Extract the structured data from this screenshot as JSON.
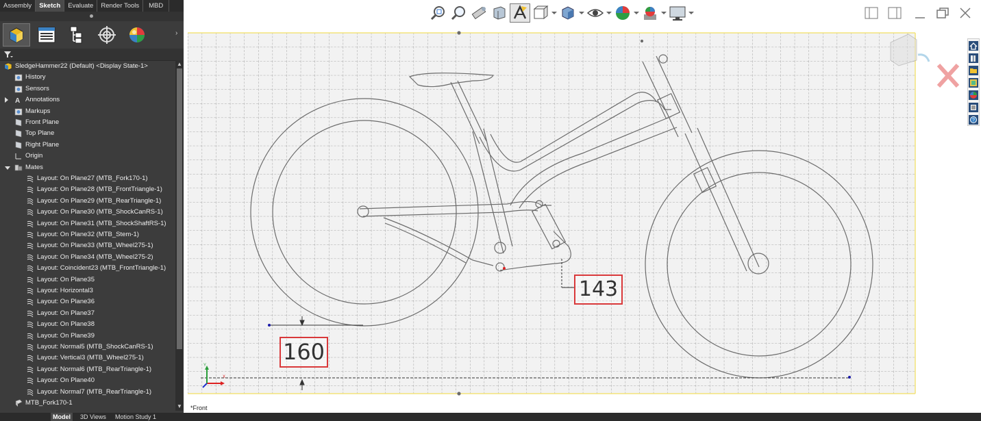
{
  "command_tabs": [
    "Assembly",
    "Sketch",
    "Evaluate",
    "Render Tools",
    "MBD"
  ],
  "active_command_tab": "Sketch",
  "manager_tabs": [
    {
      "icon": "feature-manager-icon"
    },
    {
      "icon": "property-manager-icon"
    },
    {
      "icon": "configuration-manager-icon"
    },
    {
      "icon": "dimxpert-manager-icon"
    },
    {
      "icon": "display-manager-icon"
    }
  ],
  "tree": {
    "root": "SledgeHammer22 (Default) <Display State-1>",
    "items": [
      {
        "label": "History",
        "icon": "history-icon"
      },
      {
        "label": "Sensors",
        "icon": "sensors-icon"
      },
      {
        "label": "Annotations",
        "icon": "annotations-icon"
      },
      {
        "label": "Markups",
        "icon": "markups-icon"
      },
      {
        "label": "Front Plane",
        "icon": "plane-icon"
      },
      {
        "label": "Top Plane",
        "icon": "plane-icon"
      },
      {
        "label": "Right Plane",
        "icon": "plane-icon"
      },
      {
        "label": "Origin",
        "icon": "origin-icon"
      },
      {
        "label": "Mates",
        "icon": "mates-icon"
      }
    ],
    "mates": [
      "Layout: On Plane27 (MTB_Fork170-1)",
      "Layout: On Plane28 (MTB_FrontTriangle-1)",
      "Layout: On Plane29 (MTB_RearTriangle-1)",
      "Layout: On Plane30 (MTB_ShockCanRS-1)",
      "Layout: On Plane31 (MTB_ShockShaftRS-1)",
      "Layout: On Plane32 (MTB_Stem-1)",
      "Layout: On Plane33 (MTB_Wheel275-1)",
      "Layout: On Plane34 (MTB_Wheel275-2)",
      "Layout: Coincident23 (MTB_FrontTriangle-1)",
      "Layout: On Plane35",
      "Layout: Horizontal3",
      "Layout: On Plane36",
      "Layout: On Plane37",
      "Layout: On Plane38",
      "Layout: On Plane39",
      "Layout: Normal5 (MTB_ShockCanRS-1)",
      "Layout: Vertical3 (MTB_Wheel275-1)",
      "Layout: Normal6 (MTB_RearTriangle-1)",
      "Layout: On Plane40",
      "Layout: Normal7 (MTB_RearTriangle-1)"
    ],
    "last_item": "MTB_Fork170-1"
  },
  "bottom_tabs": [
    "Model",
    "3D Views",
    "Motion Study 1"
  ],
  "active_bottom_tab": "Model",
  "view_label": "*Front",
  "dimensions": {
    "d1": "143",
    "d2": "160"
  },
  "heads_up_toolbar": [
    "zoom-to-fit-icon",
    "zoom-to-area-icon",
    "previous-view-icon",
    "section-view-icon",
    "dynamic-annotation-icon",
    "view-orientation-icon",
    "display-style-icon",
    "hide-show-items-icon",
    "edit-appearance-icon",
    "apply-scene-icon",
    "view-settings-icon"
  ],
  "colors": {
    "panel_bg": "#3c3c3c",
    "dimension_box": "#d9383a",
    "sketch_line": "#6b6b6b",
    "grid_line": "#9a9a9a"
  }
}
